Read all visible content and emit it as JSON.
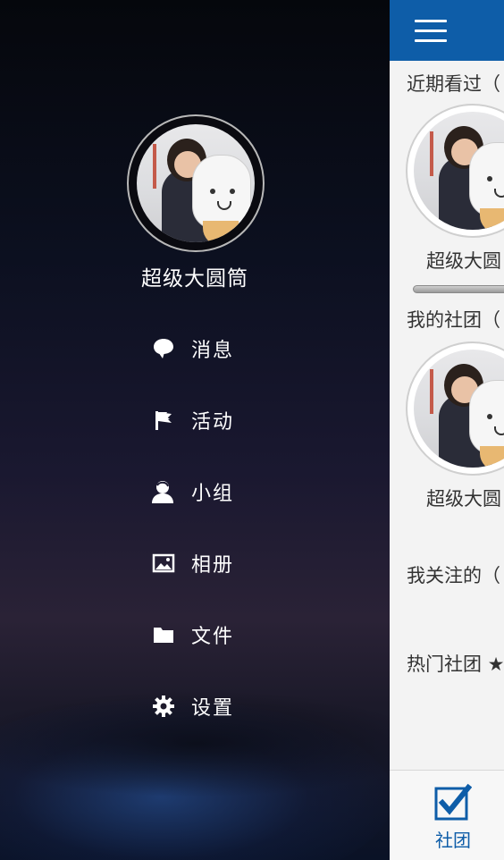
{
  "drawer": {
    "user_name": "超级大圆筒",
    "menu": [
      {
        "label": "消息",
        "icon": "message-bubble-icon"
      },
      {
        "label": "活动",
        "icon": "flag-icon"
      },
      {
        "label": "小组",
        "icon": "group-user-icon"
      },
      {
        "label": "相册",
        "icon": "photo-album-icon"
      },
      {
        "label": "文件",
        "icon": "folder-icon"
      },
      {
        "label": "设置",
        "icon": "gear-icon"
      }
    ]
  },
  "main": {
    "sections": {
      "recent": "近期看过（",
      "my_clubs": "我的社团（",
      "following": "我关注的（",
      "hot_clubs": "热门社团 ★"
    },
    "recent_card_name": "超级大圆",
    "club_card_name": "超级大圆",
    "bottom_tab": {
      "label": "社团",
      "icon": "checkbox-checked-icon"
    }
  },
  "colors": {
    "accent": "#0e5da8",
    "panel_bg": "#f3f3f3",
    "drawer_text": "#ffffff"
  }
}
